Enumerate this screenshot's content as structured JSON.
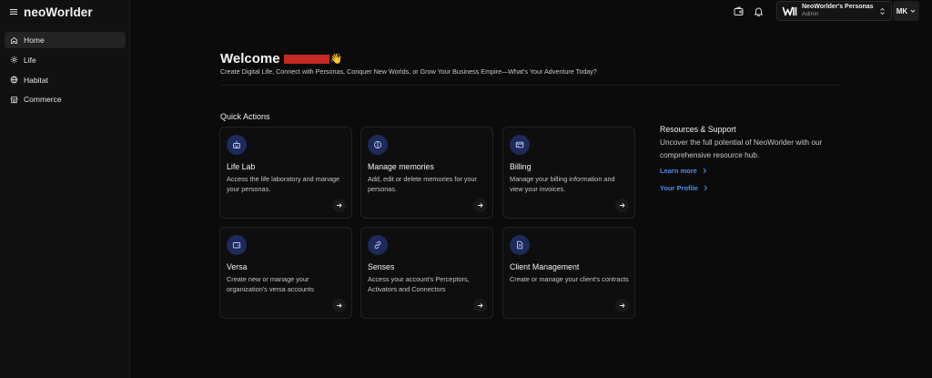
{
  "app": {
    "logo_text": "neoWorlder"
  },
  "sidebar": {
    "items": [
      {
        "label": "Home",
        "icon": "home-icon",
        "active": true
      },
      {
        "label": "Life",
        "icon": "gear-icon",
        "active": false
      },
      {
        "label": "Habitat",
        "icon": "globe-icon",
        "active": false
      },
      {
        "label": "Commerce",
        "icon": "store-icon",
        "active": false
      }
    ]
  },
  "topbar": {
    "org_name": "NeoWorlder's Personas",
    "org_role": "Admin",
    "user_initials": "MK"
  },
  "welcome": {
    "title": "Welcome",
    "wave": "👋",
    "subtitle": "Create Digital Life, Connect with Personas, Conquer New Worlds, or Grow Your Business Empire—What's Your Adventure Today?"
  },
  "quick_actions": {
    "title": "Quick Actions",
    "cards": [
      {
        "title": "Life Lab",
        "description": "Access the life laboratory and manage your personas.",
        "icon": "robot-icon"
      },
      {
        "title": "Manage memories",
        "description": "Add, edit or delete memories for your personas.",
        "icon": "brain-icon"
      },
      {
        "title": "Billing",
        "description": "Manage your billing information and view your invoices.",
        "icon": "credit-card-icon"
      },
      {
        "title": "Versa",
        "description": "Create new or manage your organization's versa accounts",
        "icon": "wallet-icon"
      },
      {
        "title": "Senses",
        "description": "Access your account's Perceptors, Activators and Connectors",
        "icon": "link-icon"
      },
      {
        "title": "Client Management",
        "description": "Create or manage your client's contracts",
        "icon": "document-icon"
      }
    ]
  },
  "resources": {
    "title": "Resources & Support",
    "description": "Uncover the full potential of NeoWorlder with our comprehensive resource hub.",
    "links": [
      {
        "label": "Learn more"
      },
      {
        "label": "Your Profile"
      }
    ]
  },
  "colors": {
    "background": "#0b0b0b",
    "sidebar": "#111111",
    "accent_link": "#4d8fe8",
    "icon_circle": "#1d2a5a",
    "redaction": "#c52a24"
  }
}
